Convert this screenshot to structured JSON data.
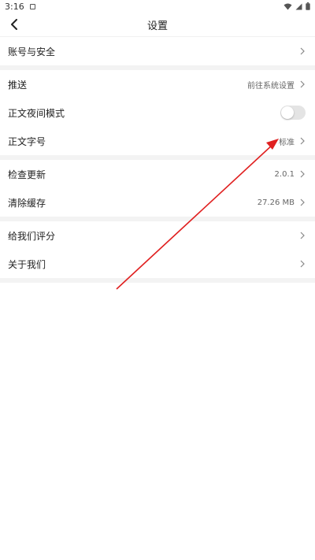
{
  "status_bar": {
    "time": "3:16",
    "icons": [
      "notification-icon",
      "wifi-icon",
      "signal-icon",
      "battery-icon"
    ]
  },
  "nav": {
    "title": "设置",
    "back_icon": "back-chevron-icon"
  },
  "settings": {
    "account": {
      "label": "账号与安全"
    },
    "push": {
      "label": "推送",
      "value": "前往系统设置"
    },
    "night_mode": {
      "label": "正文夜间模式",
      "enabled": false
    },
    "font_size": {
      "label": "正文字号",
      "value": "标准"
    },
    "check_update": {
      "label": "检查更新",
      "value": "2.0.1"
    },
    "clear_cache": {
      "label": "清除缓存",
      "value": "27.26 MB"
    },
    "rate_us": {
      "label": "给我们评分"
    },
    "about": {
      "label": "关于我们"
    }
  },
  "colors": {
    "annotation_arrow": "#e02020",
    "section_gap": "#f3f3f3",
    "toggle_off": "#e4e4e4"
  }
}
